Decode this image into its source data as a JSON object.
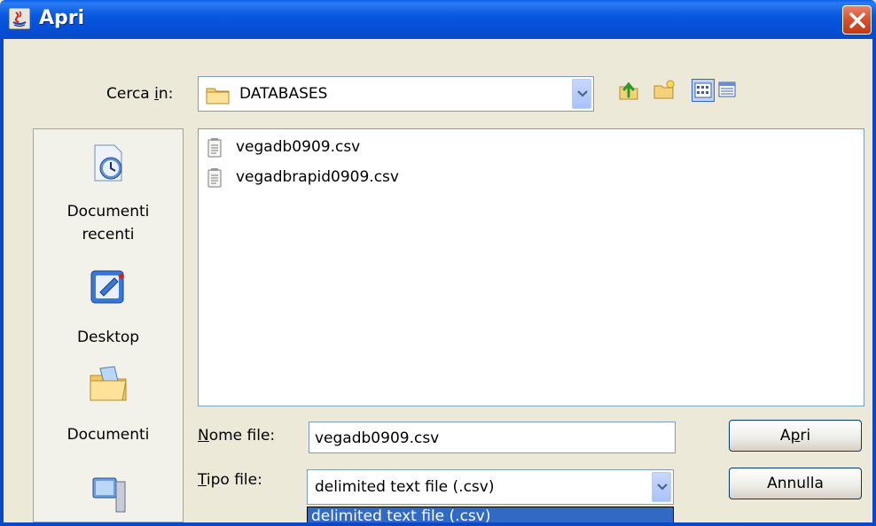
{
  "window": {
    "title": "Apri"
  },
  "look_in": {
    "label_pre": "Cerca ",
    "label_mnemonic": "i",
    "label_post": "n:",
    "value": "DATABASES"
  },
  "toolbar": {
    "up_icon": "up-folder-icon",
    "new_folder_icon": "new-folder-icon",
    "list_icon": "list-view-icon",
    "details_icon": "details-view-icon"
  },
  "sidebar": {
    "items": [
      {
        "label_line1": "Documenti",
        "label_line2": "recenti",
        "icon": "recent-documents-icon"
      },
      {
        "label_line1": "Desktop",
        "label_line2": "",
        "icon": "desktop-icon"
      },
      {
        "label_line1": "Documenti",
        "label_line2": "",
        "icon": "documents-folder-icon"
      },
      {
        "label_line1": "",
        "label_line2": "",
        "icon": "computer-icon"
      }
    ]
  },
  "files": [
    {
      "name": "vegadb0909.csv",
      "icon": "text-file-icon"
    },
    {
      "name": "vegadbrapid0909.csv",
      "icon": "text-file-icon"
    }
  ],
  "filename": {
    "label_mnemonic": "N",
    "label_rest": "ome file:",
    "value": "vegadb0909.csv"
  },
  "filetype": {
    "label_mnemonic": "T",
    "label_rest": "ipo file:",
    "value": "delimited text file (.csv)",
    "options": [
      "delimited text file (.csv)"
    ]
  },
  "buttons": {
    "open_pre": "A",
    "open_mnemonic": "p",
    "open_post": "ri",
    "cancel": "Annulla"
  },
  "colors": {
    "title_bar": "#0a58e0",
    "selection": "#316ac5",
    "dialog_bg": "#ece9d8"
  }
}
